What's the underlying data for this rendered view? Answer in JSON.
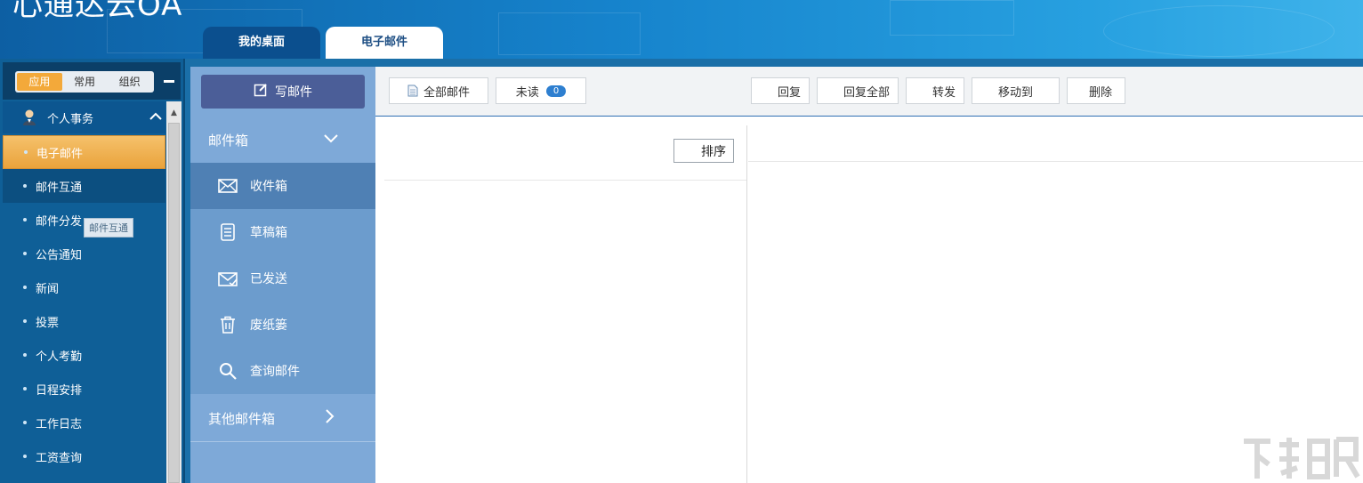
{
  "app": {
    "title": "心通达云OA"
  },
  "tabs": [
    {
      "label": "我的桌面",
      "active": false
    },
    {
      "label": "电子邮件",
      "active": true
    }
  ],
  "sidebar": {
    "segments": [
      {
        "label": "应用",
        "active": true
      },
      {
        "label": "常用",
        "active": false
      },
      {
        "label": "组织",
        "active": false
      }
    ],
    "group": {
      "label": "个人事务",
      "icon": "user-icon"
    },
    "items": [
      {
        "label": "电子邮件",
        "state": "active"
      },
      {
        "label": "邮件互通",
        "state": "hover"
      },
      {
        "label": "邮件分发",
        "state": ""
      },
      {
        "label": "公告通知",
        "state": ""
      },
      {
        "label": "新闻",
        "state": ""
      },
      {
        "label": "投票",
        "state": ""
      },
      {
        "label": "个人考勤",
        "state": ""
      },
      {
        "label": "日程安排",
        "state": ""
      },
      {
        "label": "工作日志",
        "state": ""
      },
      {
        "label": "工资查询",
        "state": ""
      }
    ],
    "tooltip": "邮件互通"
  },
  "mail": {
    "compose_label": "写邮件",
    "mailbox_header": "邮件箱",
    "boxes": [
      {
        "label": "收件箱",
        "icon": "envelope-icon",
        "selected": true
      },
      {
        "label": "草稿箱",
        "icon": "document-icon",
        "selected": false
      },
      {
        "label": "已发送",
        "icon": "sent-icon",
        "selected": false
      },
      {
        "label": "废纸篓",
        "icon": "trash-icon",
        "selected": false
      },
      {
        "label": "查询邮件",
        "icon": "search-icon",
        "selected": false
      }
    ],
    "other_header": "其他邮件箱"
  },
  "toolbar": {
    "all_mail": "全部邮件",
    "unread": "未读",
    "unread_count": "0",
    "reply": "回复",
    "reply_all": "回复全部",
    "forward": "转发",
    "move_to": "移动到",
    "delete": "删除"
  },
  "list": {
    "sort_label": "排序"
  },
  "colors": {
    "header_start": "#0d5fa3",
    "header_end": "#3fb3ea",
    "sidebar_bg": "#0f5f97",
    "active_item": "#eaa33c",
    "mailpanel_bg": "#7ea9d8",
    "compose_bg": "#4b5e98",
    "badge": "#2e7fd0"
  }
}
